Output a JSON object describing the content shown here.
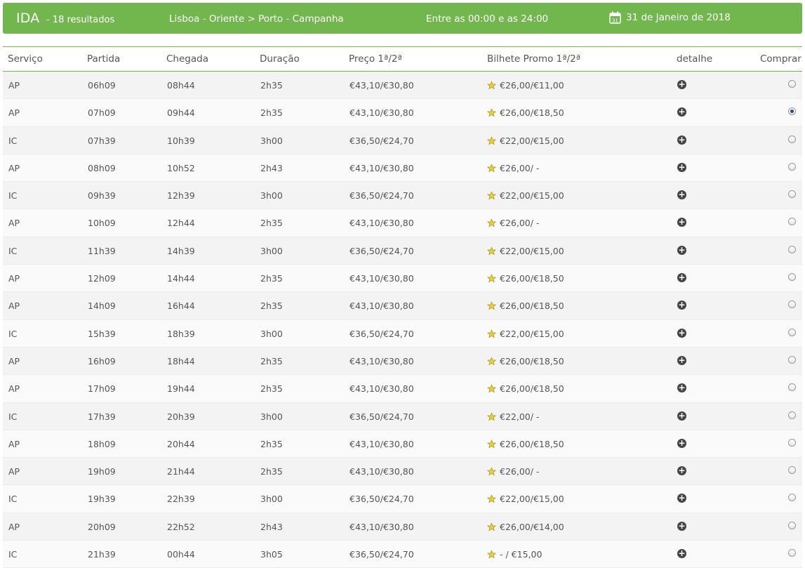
{
  "header": {
    "direction": "IDA",
    "results": "- 18 resultados",
    "route": "Lisboa - Oriente > Porto - Campanha",
    "time_window": "Entre as 00:00 e as 24:00",
    "calendar_day": "31",
    "date": "31 de Janeiro de 2018",
    "bar_color": "#72b74e"
  },
  "columns": {
    "servico": "Serviço",
    "partida": "Partida",
    "chegada": "Chegada",
    "duracao": "Duração",
    "preco": "Preço 1ª/2ª",
    "promo": "Bilhete Promo 1ª/2ª",
    "detalhe": "detalhe",
    "comprar": "Comprar"
  },
  "rows": [
    {
      "servico": "AP",
      "partida": "06h09",
      "chegada": "08h44",
      "duracao": "2h35",
      "preco": "€43,10/€30,80",
      "promo": "€26,00/€11,00",
      "selected": false
    },
    {
      "servico": "AP",
      "partida": "07h09",
      "chegada": "09h44",
      "duracao": "2h35",
      "preco": "€43,10/€30,80",
      "promo": "€26,00/€18,50",
      "selected": true
    },
    {
      "servico": "IC",
      "partida": "07h39",
      "chegada": "10h39",
      "duracao": "3h00",
      "preco": "€36,50/€24,70",
      "promo": "€22,00/€15,00",
      "selected": false
    },
    {
      "servico": "AP",
      "partida": "08h09",
      "chegada": "10h52",
      "duracao": "2h43",
      "preco": "€43,10/€30,80",
      "promo": "€26,00/ -",
      "selected": false
    },
    {
      "servico": "IC",
      "partida": "09h39",
      "chegada": "12h39",
      "duracao": "3h00",
      "preco": "€36,50/€24,70",
      "promo": "€22,00/€15,00",
      "selected": false
    },
    {
      "servico": "AP",
      "partida": "10h09",
      "chegada": "12h44",
      "duracao": "2h35",
      "preco": "€43,10/€30,80",
      "promo": "€26,00/ -",
      "selected": false
    },
    {
      "servico": "IC",
      "partida": "11h39",
      "chegada": "14h39",
      "duracao": "3h00",
      "preco": "€36,50/€24,70",
      "promo": "€22,00/€15,00",
      "selected": false
    },
    {
      "servico": "AP",
      "partida": "12h09",
      "chegada": "14h44",
      "duracao": "2h35",
      "preco": "€43,10/€30,80",
      "promo": "€26,00/€18,50",
      "selected": false
    },
    {
      "servico": "AP",
      "partida": "14h09",
      "chegada": "16h44",
      "duracao": "2h35",
      "preco": "€43,10/€30,80",
      "promo": "€26,00/€18,50",
      "selected": false
    },
    {
      "servico": "IC",
      "partida": "15h39",
      "chegada": "18h39",
      "duracao": "3h00",
      "preco": "€36,50/€24,70",
      "promo": "€22,00/€15,00",
      "selected": false
    },
    {
      "servico": "AP",
      "partida": "16h09",
      "chegada": "18h44",
      "duracao": "2h35",
      "preco": "€43,10/€30,80",
      "promo": "€26,00/€18,50",
      "selected": false
    },
    {
      "servico": "AP",
      "partida": "17h09",
      "chegada": "19h44",
      "duracao": "2h35",
      "preco": "€43,10/€30,80",
      "promo": "€26,00/€18,50",
      "selected": false
    },
    {
      "servico": "IC",
      "partida": "17h39",
      "chegada": "20h39",
      "duracao": "3h00",
      "preco": "€36,50/€24,70",
      "promo": "€22,00/ -",
      "selected": false
    },
    {
      "servico": "AP",
      "partida": "18h09",
      "chegada": "20h44",
      "duracao": "2h35",
      "preco": "€43,10/€30,80",
      "promo": "€26,00/€18,50",
      "selected": false
    },
    {
      "servico": "AP",
      "partida": "19h09",
      "chegada": "21h44",
      "duracao": "2h35",
      "preco": "€43,10/€30,80",
      "promo": "€26,00/ -",
      "selected": false
    },
    {
      "servico": "IC",
      "partida": "19h39",
      "chegada": "22h39",
      "duracao": "3h00",
      "preco": "€36,50/€24,70",
      "promo": "€22,00/€15,00",
      "selected": false
    },
    {
      "servico": "AP",
      "partida": "20h09",
      "chegada": "22h52",
      "duracao": "2h43",
      "preco": "€43,10/€30,80",
      "promo": "€26,00/€14,00",
      "selected": false
    },
    {
      "servico": "IC",
      "partida": "21h39",
      "chegada": "00h44",
      "duracao": "3h05",
      "preco": "€36,50/€24,70",
      "promo": "- / €15,00",
      "selected": false
    }
  ],
  "icons": {
    "calendar": "calendar-icon",
    "promo": "star-icon",
    "detail": "plus-circle-icon",
    "select": "radio-button"
  },
  "detail_glyph": "+"
}
